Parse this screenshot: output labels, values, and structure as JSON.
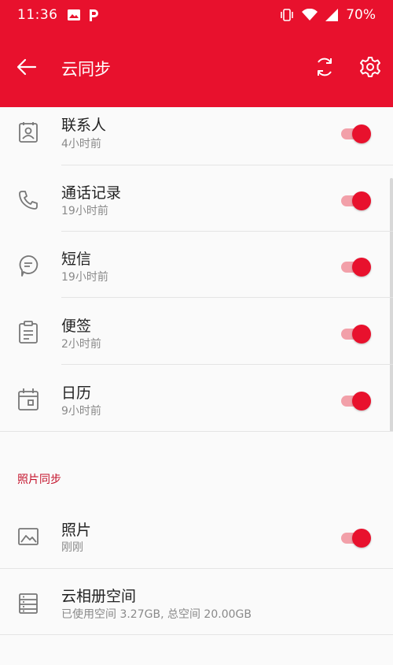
{
  "status_bar": {
    "time": "11:36",
    "battery": "70%",
    "icons": [
      "image-icon",
      "p-app-icon",
      "vibrate-icon",
      "wifi-icon",
      "signal-icon"
    ]
  },
  "toolbar": {
    "title": "云同步",
    "back_icon": "arrow-left-icon",
    "sync_icon": "sync-icon",
    "settings_icon": "gear-icon"
  },
  "sync_items": [
    {
      "title": "联系人",
      "subtitle": "4小时前",
      "icon": "contacts-icon",
      "enabled": true
    },
    {
      "title": "通话记录",
      "subtitle": "19小时前",
      "icon": "phone-icon",
      "enabled": true
    },
    {
      "title": "短信",
      "subtitle": "19小时前",
      "icon": "message-icon",
      "enabled": true
    },
    {
      "title": "便签",
      "subtitle": "2小时前",
      "icon": "clipboard-icon",
      "enabled": true
    },
    {
      "title": "日历",
      "subtitle": "9小时前",
      "icon": "calendar-icon",
      "enabled": true
    }
  ],
  "photo_section": {
    "header": "照片同步",
    "items": [
      {
        "title": "照片",
        "subtitle": "刚刚",
        "icon": "image-icon",
        "enabled": true
      },
      {
        "title": "云相册空间",
        "subtitle": "已使用空间 3.27GB, 总空间 20.00GB",
        "icon": "storage-icon"
      }
    ]
  },
  "colors": {
    "accent": "#e8112d",
    "toggle_track": "#f2a0a9",
    "section_header": "#c4112a"
  }
}
